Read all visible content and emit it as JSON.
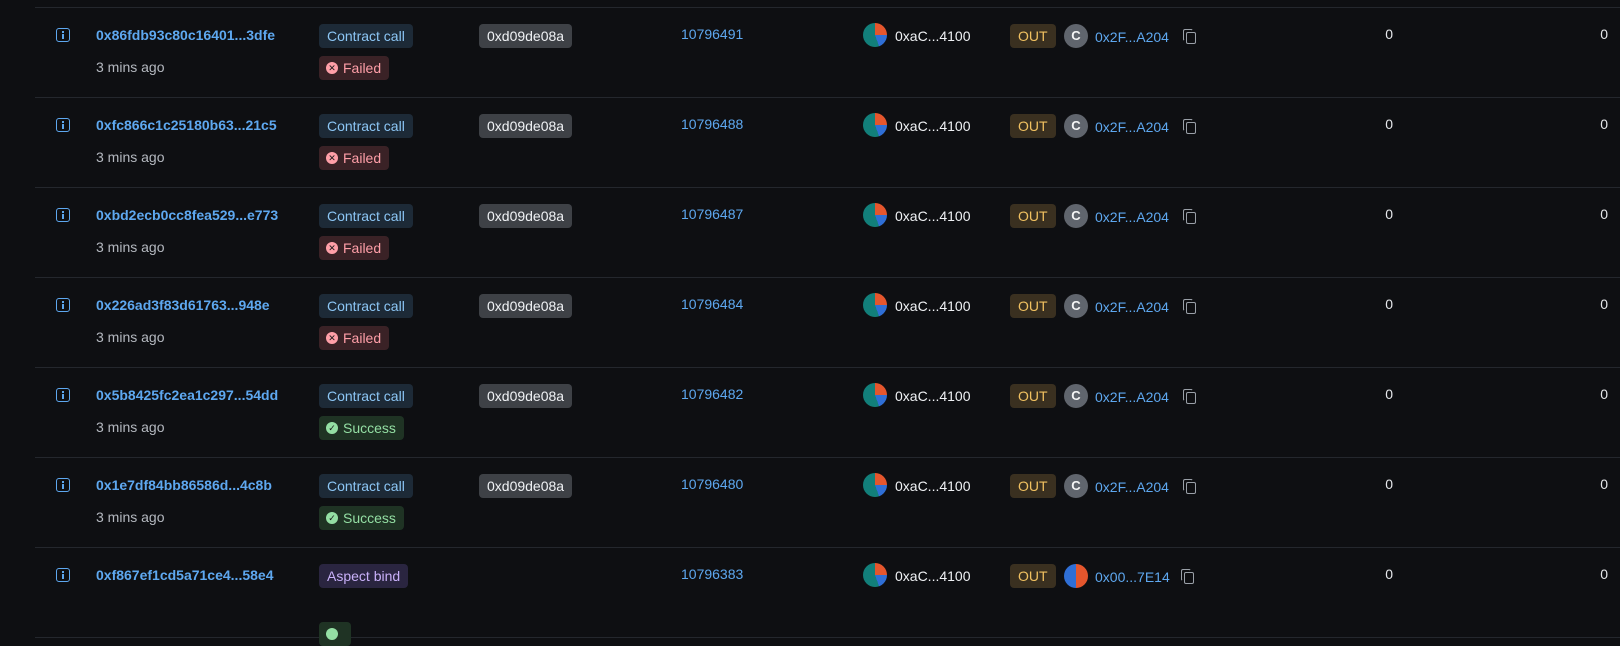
{
  "transactions": [
    {
      "hash": "0x86fdb93c80c16401...3dfe",
      "age": "3 mins ago",
      "type": "Contract call",
      "status": "Failed",
      "method": "0xd09de08a",
      "block": "10796491",
      "from": "0xaC...4100",
      "direction": "OUT",
      "to_icon": "C",
      "to": "0x2F...A204",
      "value": "0",
      "fee": "0"
    },
    {
      "hash": "0xfc866c1c25180b63...21c5",
      "age": "3 mins ago",
      "type": "Contract call",
      "status": "Failed",
      "method": "0xd09de08a",
      "block": "10796488",
      "from": "0xaC...4100",
      "direction": "OUT",
      "to_icon": "C",
      "to": "0x2F...A204",
      "value": "0",
      "fee": "0"
    },
    {
      "hash": "0xbd2ecb0cc8fea529...e773",
      "age": "3 mins ago",
      "type": "Contract call",
      "status": "Failed",
      "method": "0xd09de08a",
      "block": "10796487",
      "from": "0xaC...4100",
      "direction": "OUT",
      "to_icon": "C",
      "to": "0x2F...A204",
      "value": "0",
      "fee": "0"
    },
    {
      "hash": "0x226ad3f83d61763...948e",
      "age": "3 mins ago",
      "type": "Contract call",
      "status": "Failed",
      "method": "0xd09de08a",
      "block": "10796484",
      "from": "0xaC...4100",
      "direction": "OUT",
      "to_icon": "C",
      "to": "0x2F...A204",
      "value": "0",
      "fee": "0"
    },
    {
      "hash": "0x5b8425fc2ea1c297...54dd",
      "age": "3 mins ago",
      "type": "Contract call",
      "status": "Success",
      "method": "0xd09de08a",
      "block": "10796482",
      "from": "0xaC...4100",
      "direction": "OUT",
      "to_icon": "C",
      "to": "0x2F...A204",
      "value": "0",
      "fee": "0"
    },
    {
      "hash": "0x1e7df84bb86586d...4c8b",
      "age": "3 mins ago",
      "type": "Contract call",
      "status": "Success",
      "method": "0xd09de08a",
      "block": "10796480",
      "from": "0xaC...4100",
      "direction": "OUT",
      "to_icon": "C",
      "to": "0x2F...A204",
      "value": "0",
      "fee": "0"
    },
    {
      "hash": "0xf867ef1cd5a71ce4...58e4",
      "age": "",
      "type": "Aspect bind",
      "status": "",
      "method": "",
      "block": "10796383",
      "from": "0xaC...4100",
      "direction": "OUT",
      "to_icon": "",
      "to": "0x00...7E14",
      "value": "0",
      "fee": "0"
    }
  ],
  "icons": {
    "info": "info-square-icon",
    "copy": "copy-icon",
    "failed": "x-circle-icon",
    "success": "check-circle-icon"
  },
  "colors": {
    "link": "#5ea8f0",
    "failed": "#ff9fa8",
    "success": "#94dfa4",
    "out": "#f0c060"
  }
}
